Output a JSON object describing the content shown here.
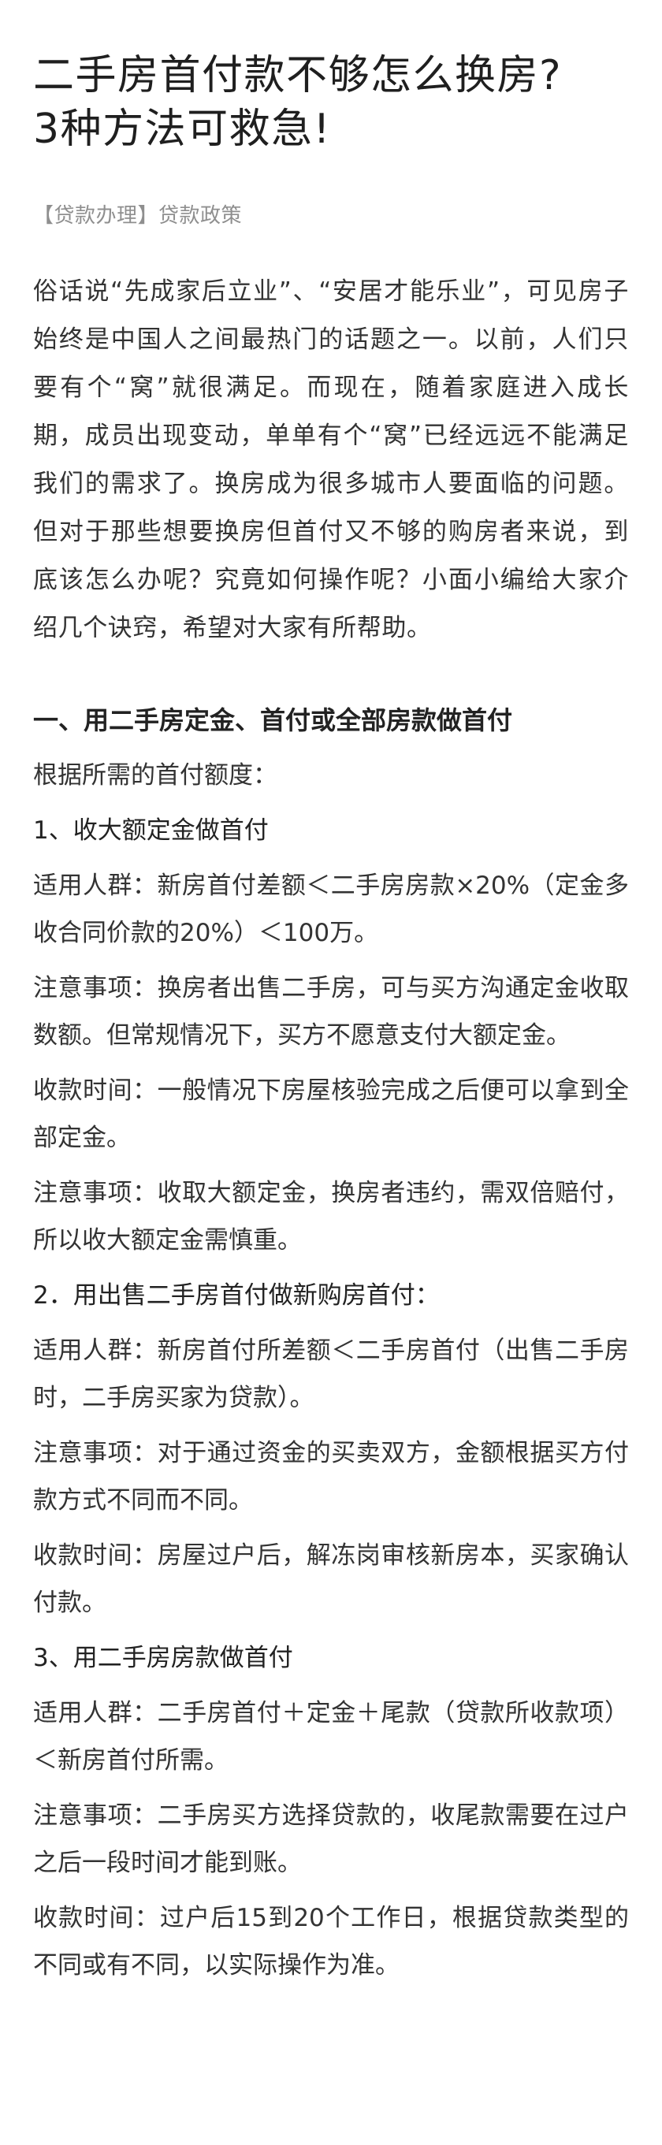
{
  "article": {
    "title_line1": "二手房首付款不够怎么换房?",
    "title_line2": "3种方法可救急!",
    "category": "【贷款办理】贷款政策",
    "intro": "俗话说“先成家后立业”、“安居才能乐业”，可见房子始终是中国人之间最热门的话题之一。以前，人们只要有个“窝”就很满足。而现在，随着家庭进入成长期，成员出现变动，单单有个“窝”已经远远不能满足我们的需求了。换房成为很多城市人要面临的问题。但对于那些想要换房但首付又不够的购房者来说，到底该怎么办呢？究竟如何操作呢？小面小编给大家介绍几个诀窍，希望对大家有所帮助。",
    "section1_heading": "一、用二手房定金、首付或全部房款做首付",
    "section1_lead": "根据所需的首付额度：",
    "method1": {
      "heading": "1、收大额定金做首付",
      "applicable": "适用人群：新房首付差额＜二手房房款×20%（定金多收合同价款的20%）＜100万。",
      "note": "注意事项：换房者出售二手房，可与买方沟通定金收取数额。但常规情况下，买方不愿意支付大额定金。",
      "time": "收款时间：一般情况下房屋核验完成之后便可以拿到全部定金。",
      "note2": "注意事项：收取大额定金，换房者违约，需双倍赔付，所以收大额定金需慎重。"
    },
    "method2": {
      "heading": "2．用出售二手房首付做新购房首付：",
      "applicable": "适用人群：新房首付所差额＜二手房首付（出售二手房时，二手房买家为贷款）。",
      "note": "注意事项：对于通过资金的买卖双方，金额根据买方付款方式不同而不同。",
      "time": "收款时间：房屋过户后，解冻岗审核新房本，买家确认付款。"
    },
    "method3": {
      "heading": "3、用二手房房款做首付",
      "applicable": "适用人群：二手房首付＋定金＋尾款（贷款所收款项）＜新房首付所需。",
      "note": "注意事项：二手房买方选择贷款的，收尾款需要在过户之后一段时间才能到账。",
      "time": "收款时间：过户后15到20个工作日，根据贷款类型的不同或有不同，以实际操作为准。"
    }
  }
}
